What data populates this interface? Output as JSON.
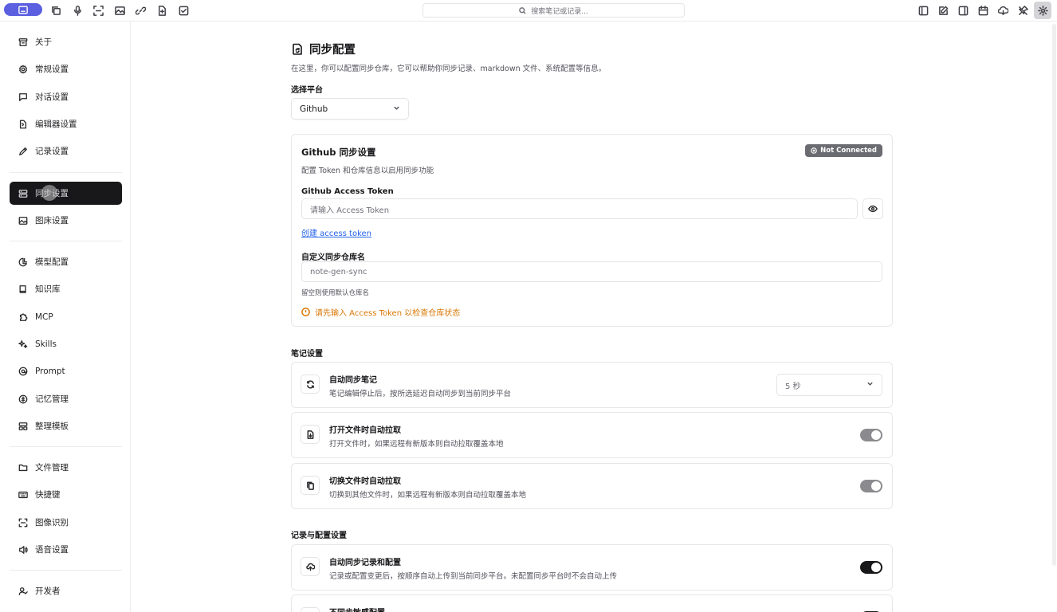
{
  "toolbar": {
    "search_placeholder": "搜索笔记或记录..."
  },
  "sidebar": {
    "items": [
      {
        "label": "关于",
        "icon": "archive-icon"
      },
      {
        "label": "常规设置",
        "icon": "settings-icon"
      },
      {
        "label": "对话设置",
        "icon": "chat-icon"
      },
      {
        "label": "编辑器设置",
        "icon": "editor-icon"
      },
      {
        "label": "记录设置",
        "icon": "pen-icon"
      },
      {
        "label": "同步设置",
        "icon": "sync-icon"
      },
      {
        "label": "图床设置",
        "icon": "image-icon"
      },
      {
        "label": "模型配置",
        "icon": "model-icon"
      },
      {
        "label": "知识库",
        "icon": "book-icon"
      },
      {
        "label": "MCP",
        "icon": "puzzle-icon"
      },
      {
        "label": "Skills",
        "icon": "sparkles-icon"
      },
      {
        "label": "Prompt",
        "icon": "prompt-icon"
      },
      {
        "label": "记忆管理",
        "icon": "memory-icon"
      },
      {
        "label": "整理模板",
        "icon": "template-icon"
      },
      {
        "label": "文件管理",
        "icon": "folder-icon"
      },
      {
        "label": "快捷键",
        "icon": "keyboard-icon"
      },
      {
        "label": "图像识别",
        "icon": "scan-icon"
      },
      {
        "label": "语音设置",
        "icon": "speaker-icon"
      },
      {
        "label": "开发者",
        "icon": "developer-icon"
      }
    ],
    "active_index": 5
  },
  "page": {
    "title": "同步配置",
    "description": "在这里，你可以配置同步仓库，它可以帮助你同步记录、markdown 文件、系统配置等信息。",
    "platform_label": "选择平台",
    "platform_value": "Github"
  },
  "github_card": {
    "title": "Github 同步设置",
    "subtitle": "配置 Token 和仓库信息以启用同步功能",
    "status": "Not Connected",
    "token_label": "Github Access Token",
    "token_placeholder": "请输入 Access Token",
    "create_link": "创建 access token",
    "repo_label": "自定义同步仓库名",
    "repo_placeholder": "note-gen-sync",
    "repo_hint": "留空则使用默认仓库名",
    "warning": "请先输入 Access Token 以检查仓库状态"
  },
  "notes_section": {
    "title": "笔记设置",
    "rows": [
      {
        "title": "自动同步笔记",
        "desc": "笔记编辑停止后，按所选延迟自动同步到当前同步平台",
        "control": "select",
        "value": "5 秒"
      },
      {
        "title": "打开文件时自动拉取",
        "desc": "打开文件时，如果远程有新版本则自动拉取覆盖本地",
        "control": "toggle",
        "on": false
      },
      {
        "title": "切换文件时自动拉取",
        "desc": "切换到其他文件时，如果远程有新版本则自动拉取覆盖本地",
        "control": "toggle",
        "on": false
      }
    ]
  },
  "records_section": {
    "title": "记录与配置设置",
    "rows": [
      {
        "title": "自动同步记录和配置",
        "desc": "记录或配置变更后，按顺序自动上传到当前同步平台。未配置同步平台时不会自动上传",
        "control": "toggle",
        "on": true
      },
      {
        "title": "不同步敏感配置",
        "desc": "",
        "control": "toggle",
        "on": true
      }
    ]
  },
  "colors": {
    "accent": "#5b5fe0",
    "warning": "#d97706",
    "link": "#2563eb",
    "active_nav": "#18181b"
  }
}
